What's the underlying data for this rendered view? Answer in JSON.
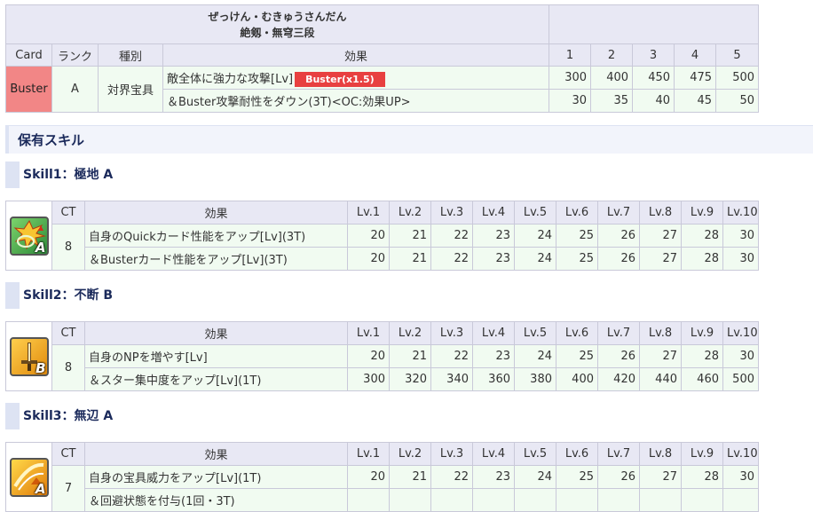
{
  "np": {
    "ruby": "ぜっけん・むきゅうさんだん",
    "name": "絶剱・無穹三段",
    "headers": [
      "Card",
      "ランク",
      "種別",
      "効果",
      "1",
      "2",
      "3",
      "4",
      "5"
    ],
    "card": "Buster",
    "rank": "A",
    "type": "対界宝具",
    "effects": [
      {
        "text": "敵全体に強力な攻撃[Lv]",
        "badge": "Buster(x1.5)",
        "values": [
          "300",
          "400",
          "450",
          "475",
          "500"
        ]
      },
      {
        "text": "＆Buster攻撃耐性をダウン(3T)<OC:効果UP>",
        "values": [
          "30",
          "35",
          "40",
          "45",
          "50"
        ]
      }
    ],
    "colors": {
      "buster": "#f28686",
      "badge": "#e84040"
    }
  },
  "skills_section": {
    "title": "保有スキル"
  },
  "skill_headers": [
    "CT",
    "効果",
    "Lv.1",
    "Lv.2",
    "Lv.3",
    "Lv.4",
    "Lv.5",
    "Lv.6",
    "Lv.7",
    "Lv.8",
    "Lv.9",
    "Lv.10"
  ],
  "skills": [
    {
      "title": "Skill1：極地 A",
      "icon": "quick-buster-up-icon",
      "icon_rank": "A",
      "ct": "8",
      "effects": [
        {
          "text": "自身のQuickカード性能をアップ[Lv](3T)",
          "values": [
            "20",
            "21",
            "22",
            "23",
            "24",
            "25",
            "26",
            "27",
            "28",
            "30"
          ]
        },
        {
          "text": "＆Busterカード性能をアップ[Lv](3T)",
          "values": [
            "20",
            "21",
            "22",
            "23",
            "24",
            "25",
            "26",
            "27",
            "28",
            "30"
          ]
        }
      ]
    },
    {
      "title": "Skill2：不断 B",
      "icon": "sword-icon",
      "icon_rank": "B",
      "ct": "8",
      "effects": [
        {
          "text": "自身のNPを増やす[Lv]",
          "values": [
            "20",
            "21",
            "22",
            "23",
            "24",
            "25",
            "26",
            "27",
            "28",
            "30"
          ]
        },
        {
          "text": "＆スター集中度をアップ[Lv](1T)",
          "values": [
            "300",
            "320",
            "340",
            "360",
            "380",
            "400",
            "420",
            "440",
            "460",
            "500"
          ]
        }
      ]
    },
    {
      "title": "Skill3：無辺 A",
      "icon": "np-damage-up-icon",
      "icon_rank": "A",
      "ct": "7",
      "effects": [
        {
          "text": "自身の宝具威力をアップ[Lv](1T)",
          "values": [
            "20",
            "21",
            "22",
            "23",
            "24",
            "25",
            "26",
            "27",
            "28",
            "30"
          ]
        },
        {
          "text": "＆回避状態を付与(1回・3T)",
          "values": []
        }
      ]
    }
  ]
}
